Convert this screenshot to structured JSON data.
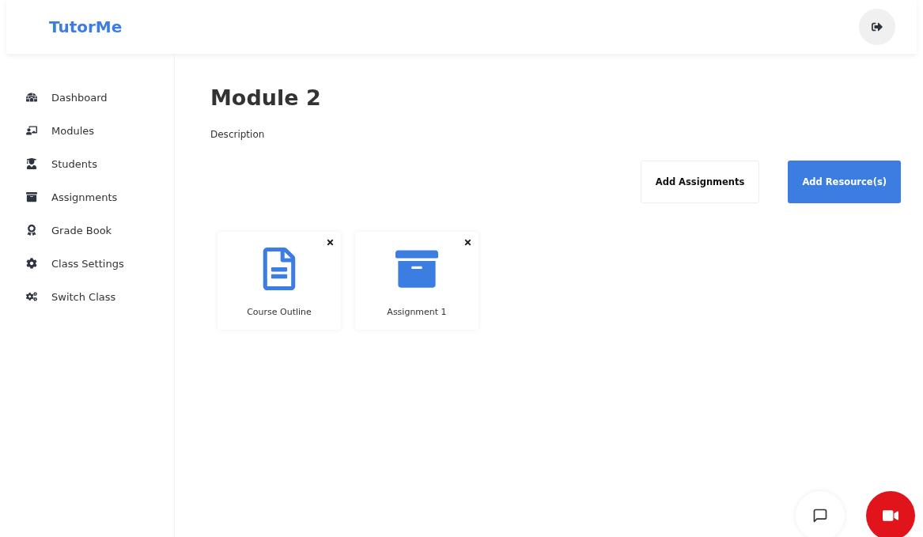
{
  "header": {
    "brand": "TutorMe"
  },
  "sidebar": {
    "items": [
      {
        "label": "Dashboard"
      },
      {
        "label": "Modules"
      },
      {
        "label": "Students"
      },
      {
        "label": "Assignments"
      },
      {
        "label": "Grade Book"
      },
      {
        "label": "Class Settings"
      },
      {
        "label": "Switch Class"
      }
    ]
  },
  "page": {
    "title": "Module 2",
    "description": "Description"
  },
  "actions": [
    {
      "label": "Add Assignments",
      "kind": "outline"
    },
    {
      "label": "Add Resource(s)",
      "kind": "primary"
    }
  ],
  "cards": [
    {
      "label": "Course Outline",
      "kind": "document"
    },
    {
      "label": "Assignment 1",
      "kind": "archive"
    }
  ]
}
